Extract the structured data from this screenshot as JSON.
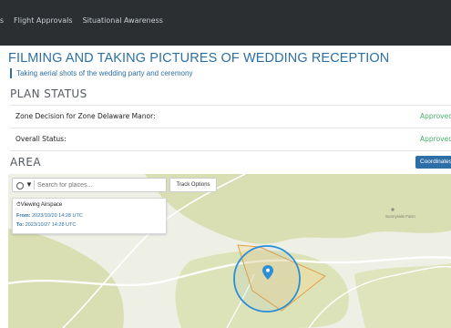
{
  "nav": {
    "items": [
      "vals",
      "Flight Approvals",
      "Situational Awareness"
    ]
  },
  "plan": {
    "title": "FILMING AND TAKING PICTURES OF WEDDING RECEPTION",
    "description": "Taking aerial shots of the wedding party and ceremony"
  },
  "plan_status": {
    "heading": "PLAN STATUS",
    "rows": [
      {
        "label": "Zone Decision for Zone Delaware Manor:",
        "value": "Approved"
      },
      {
        "label": "Overall Status:",
        "value": "Approved"
      }
    ]
  },
  "area": {
    "heading": "AREA",
    "coordinates_button": "Coordinates",
    "search": {
      "placeholder": "Search for places..."
    },
    "track_options_button": "Track Options",
    "airspace_card": {
      "title": "Viewing Airspace",
      "from_label": "From:",
      "from_value": "2023/10/20 14:28 UTC",
      "to_label": "To:",
      "to_value": "2023/10/27 14:28 UTC"
    },
    "map_label": "Sunnyside Farm"
  },
  "colors": {
    "nav_bg": "#2b2f32",
    "accent_blue": "#2d6fa3",
    "status_green": "#4bb36d",
    "zone_outline": "#e2a24a",
    "radius_circle": "#2b8ed6",
    "map_green": "#d9dfb3"
  }
}
